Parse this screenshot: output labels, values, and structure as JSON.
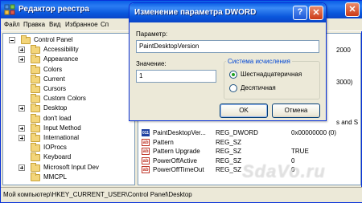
{
  "regedit": {
    "title": "Редактор реестра",
    "menu": [
      "Файл",
      "Правка",
      "Вид",
      "Избранное",
      "Сп"
    ],
    "tree": [
      {
        "label": "Control Panel",
        "expander": "minus",
        "indent": 0
      },
      {
        "label": "Accessibility",
        "expander": "plus",
        "indent": 1
      },
      {
        "label": "Appearance",
        "expander": "plus",
        "indent": 1
      },
      {
        "label": "Colors",
        "expander": "none",
        "indent": 1
      },
      {
        "label": "Current",
        "expander": "none",
        "indent": 1
      },
      {
        "label": "Cursors",
        "expander": "none",
        "indent": 1
      },
      {
        "label": "Custom Colors",
        "expander": "none",
        "indent": 1
      },
      {
        "label": "Desktop",
        "expander": "plus",
        "indent": 1
      },
      {
        "label": "don't load",
        "expander": "none",
        "indent": 1
      },
      {
        "label": "Input Method",
        "expander": "plus",
        "indent": 1
      },
      {
        "label": "International",
        "expander": "plus",
        "indent": 1
      },
      {
        "label": "IOProcs",
        "expander": "none",
        "indent": 1
      },
      {
        "label": "Keyboard",
        "expander": "none",
        "indent": 1
      },
      {
        "label": "Microsoft Input Dev",
        "expander": "plus",
        "indent": 1
      },
      {
        "label": "MMCPL",
        "expander": "none",
        "indent": 1
      }
    ],
    "list_partials": {
      "top_right": "2000",
      "mid_right": "3000)",
      "side_right": "s and S"
    },
    "values": [
      {
        "name": "PaintDesktopVer...",
        "type": "REG_DWORD",
        "data": "0x00000000 (0)",
        "kind": "dword"
      },
      {
        "name": "Pattern",
        "type": "REG_SZ",
        "data": "",
        "kind": "sz"
      },
      {
        "name": "Pattern Upgrade",
        "type": "REG_SZ",
        "data": "TRUE",
        "kind": "sz"
      },
      {
        "name": "PowerOffActive",
        "type": "REG_SZ",
        "data": "0",
        "kind": "sz"
      },
      {
        "name": "PowerOffTimeOut",
        "type": "REG_SZ",
        "data": "0",
        "kind": "sz"
      }
    ],
    "status": "Мой компьютер\\HKEY_CURRENT_USER\\Control Panel\\Desktop",
    "watermark": "SdaVo.ru"
  },
  "dialog": {
    "title": "Изменение параметра DWORD",
    "param_label": "Параметр:",
    "param_value": "PaintDesktopVersion",
    "value_label": "Значение:",
    "value_value": "1",
    "base_group_label": "Система исчисления",
    "radio_hex": "Шестнадцатеричная",
    "radio_dec": "Десятичная",
    "selected_base": "hex",
    "ok_label": "OK",
    "cancel_label": "Отмена",
    "help_symbol": "?",
    "close_symbol": "✕"
  }
}
